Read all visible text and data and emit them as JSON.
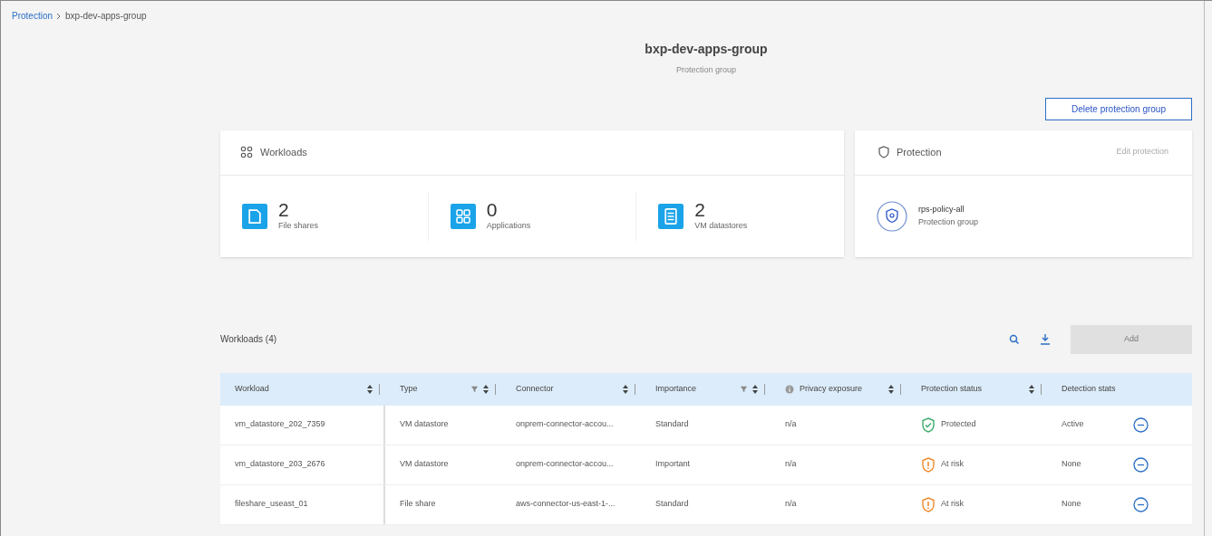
{
  "breadcrumb": [
    {
      "label": "Protection",
      "link": true
    },
    {
      "label": "bxp-dev-apps-group",
      "link": false
    }
  ],
  "header": {
    "title": "bxp-dev-apps-group",
    "subtitle": "Protection group"
  },
  "delete_button": "Delete protection group",
  "workloads_card": {
    "title": "Workloads",
    "stats": [
      {
        "kind": "file",
        "count": "2",
        "label": "File shares"
      },
      {
        "kind": "apps",
        "count": "0",
        "label": "Applications"
      },
      {
        "kind": "datastore",
        "count": "2",
        "label": "VM datastores"
      }
    ]
  },
  "protection_card": {
    "title": "Protection",
    "edit_link": "Edit protection",
    "policy": "rps-policy-all",
    "policy_type": "Protection group"
  },
  "table_toolbar": {
    "title": "Workloads (4)",
    "add_button": {
      "label": "Add",
      "disabled": true
    }
  },
  "table": {
    "columns": [
      {
        "label": "Workload",
        "filter": false,
        "sort": true,
        "info": false
      },
      {
        "label": "Type",
        "filter": true,
        "sort": true,
        "info": false
      },
      {
        "label": "Connector",
        "filter": false,
        "sort": true,
        "info": false
      },
      {
        "label": "Importance",
        "filter": true,
        "sort": true,
        "info": false
      },
      {
        "label": "Privacy exposure",
        "filter": false,
        "sort": true,
        "info": true
      },
      {
        "label": "Protection status",
        "filter": false,
        "sort": true,
        "info": false
      },
      {
        "label": "Detection stats",
        "filter": false,
        "sort": false,
        "info": false
      }
    ],
    "rows": [
      {
        "workload": "vm_datastore_202_7359",
        "type": "VM datastore",
        "connector": "onprem-connector-accou...",
        "importance": "Standard",
        "privacy": "n/a",
        "status": {
          "kind": "protected",
          "label": "Protected"
        },
        "detection": "Active"
      },
      {
        "workload": "vm_datastore_203_2676",
        "type": "VM datastore",
        "connector": "onprem-connector-accou...",
        "importance": "Important",
        "privacy": "n/a",
        "status": {
          "kind": "at_risk",
          "label": "At risk"
        },
        "detection": "None"
      },
      {
        "workload": "fileshare_useast_01",
        "type": "File share",
        "connector": "aws-connector-us-east-1-...",
        "importance": "Standard",
        "privacy": "n/a",
        "status": {
          "kind": "at_risk",
          "label": "At risk"
        },
        "detection": "None"
      }
    ]
  }
}
